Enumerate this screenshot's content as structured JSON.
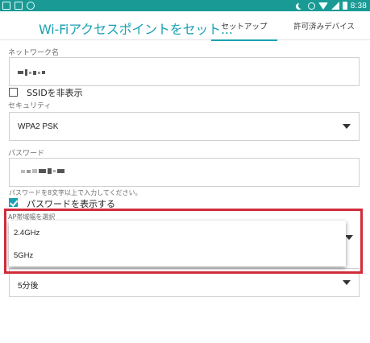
{
  "status_bar": {
    "time": "8:38",
    "bg_color": "#1a9a95"
  },
  "app_bar": {
    "title": "Wi-Fiアクセスポイントをセット...",
    "tabs": [
      {
        "label": "セットアップ",
        "selected": true
      },
      {
        "label": "許可済みデバイス",
        "selected": false
      }
    ],
    "accent_color": "#1aa1b3"
  },
  "form": {
    "network_name": {
      "label": "ネットワーク名",
      "value_masked": true
    },
    "hide_ssid": {
      "label": "SSIDを非表示",
      "checked": false
    },
    "security": {
      "label": "セキュリティ",
      "value": "WPA2 PSK"
    },
    "password": {
      "label": "パスワード",
      "value_masked": true,
      "hint": "パスワードを8文字以上で入力してください。"
    },
    "show_password": {
      "label": "パスワードを表示する",
      "checked": true
    },
    "ap_band": {
      "label": "AP帯域幅を選択",
      "options": [
        "2.4GHz",
        "5GHz"
      ]
    },
    "timeout": {
      "value": "5分後"
    }
  },
  "highlight_color": "#d12c3a"
}
